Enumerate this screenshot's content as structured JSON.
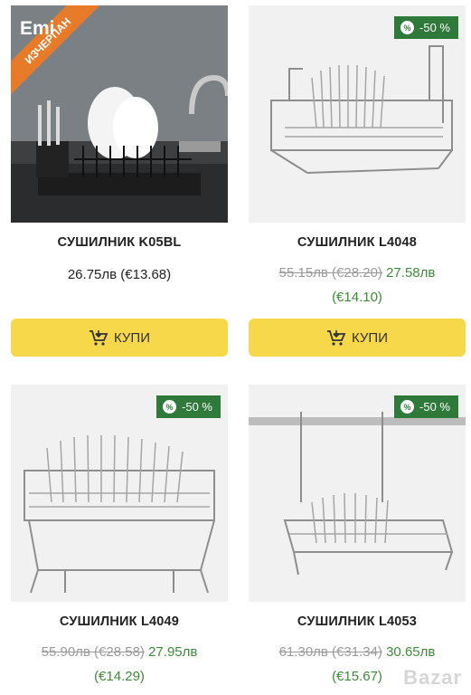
{
  "products": [
    {
      "title": "СУШИЛНИК K05BL",
      "price": "26.75лв (€13.68)",
      "ribbon": "ИЗЧЕРПАН",
      "brand": "Emi",
      "button": "КУПИ"
    },
    {
      "title": "СУШИЛНИК L4048",
      "badge": "-50 %",
      "old_price": "55.15лв (€28.20)",
      "new_price": "27.58лв",
      "new_price_eur": "(€14.10)",
      "button": "КУПИ"
    },
    {
      "title": "СУШИЛНИК L4049",
      "badge": "-50 %",
      "old_price": "55.90лв (€28.58)",
      "new_price": "27.95лв",
      "new_price_eur": "(€14.29)"
    },
    {
      "title": "СУШИЛНИК L4053",
      "badge": "-50 %",
      "old_price": "61.30лв (€31.34)",
      "new_price": "30.65лв",
      "new_price_eur": "(€15.67)"
    }
  ],
  "watermark": "Bazar",
  "colors": {
    "button": "#f6d84a",
    "badge": "#2f7a3a",
    "ribbon": "#e87b2a",
    "sale_price": "#3f8a3a"
  },
  "icons": {
    "cart": "cart-icon",
    "percent": "percent-icon"
  }
}
